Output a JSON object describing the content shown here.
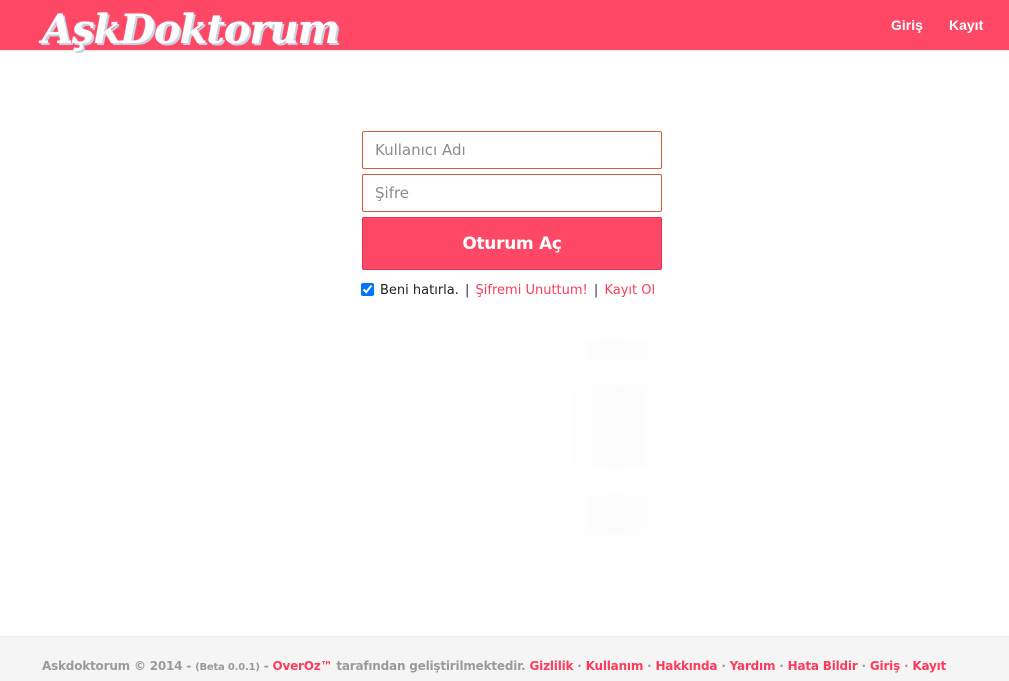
{
  "header": {
    "logo_text": "AşkDoktorum",
    "nav": {
      "login_label": "Giriş",
      "register_label": "Kayıt"
    }
  },
  "login_form": {
    "username_placeholder": "Kullanıcı Adı",
    "password_placeholder": "Şifre",
    "submit_label": "Oturum Aç",
    "remember_label": "Beni hatırla.",
    "remember_checked": true,
    "separator": "|",
    "forgot_label": "Şifremi Unuttum!",
    "register_label": "Kayıt Ol"
  },
  "footer": {
    "copyright": "Askdoktorum © 2014 -",
    "version": "(Beta 0.0.1)",
    "dash": "-",
    "developer_label": "OverOz™",
    "developed_text": "tarafından geliştirilmektedir.",
    "dot": "·",
    "links": {
      "privacy": "Gizlilik",
      "terms": "Kullanım",
      "about": "Hakkında",
      "help": "Yardım",
      "report": "Hata Bildir",
      "login": "Giriş",
      "register": "Kayıt"
    }
  },
  "colors": {
    "brand": "#ff4866",
    "link": "#ff3c5c",
    "input_border": "#d35f43",
    "footer_bg": "#f5f5f5",
    "footer_text": "#9b9b9b"
  }
}
